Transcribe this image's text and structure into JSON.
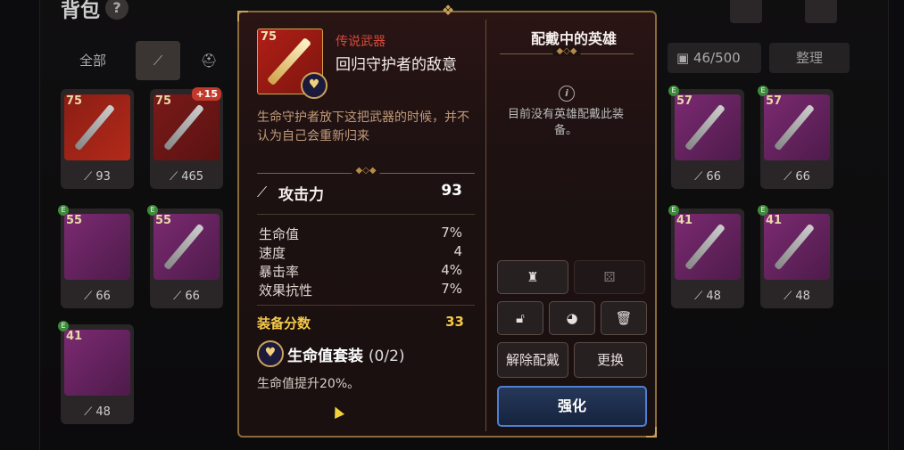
{
  "background": {
    "title": "背包",
    "help_icon": "question-icon",
    "tabs": [
      "全部",
      "",
      ""
    ],
    "inventory_count": "46/500",
    "sort_label": "整理",
    "slots_left": [
      {
        "level": "75",
        "power": "93"
      },
      {
        "level": "75",
        "power": "465",
        "plus": "+15"
      },
      {
        "level": "55",
        "power": "66"
      },
      {
        "level": "55",
        "power": "66"
      },
      {
        "level": "41",
        "power": "48"
      }
    ],
    "slots_right": [
      {
        "level": "57",
        "power": "66"
      },
      {
        "level": "57",
        "power": "66"
      },
      {
        "level": "41",
        "power": "48"
      },
      {
        "level": "41",
        "power": "48"
      }
    ]
  },
  "item": {
    "level": "75",
    "rarity": "传说武器",
    "name": "回归守护者的敌意",
    "flavor": "生命守护者放下这把武器的时候，并不认为自己会重新归来",
    "attack_label": "攻击力",
    "attack_value": "93",
    "stats": [
      {
        "name": "生命值",
        "value": "7%"
      },
      {
        "name": "速度",
        "value": "4"
      },
      {
        "name": "暴击率",
        "value": "4%"
      },
      {
        "name": "效果抗性",
        "value": "7%"
      }
    ],
    "gear_score_label": "装备分数",
    "gear_score_value": "33",
    "set_name": "生命值套装",
    "set_count": "(0/2)",
    "set_effect": "生命值提升20%。"
  },
  "equipped": {
    "title": "配戴中的英雄",
    "empty_text": "目前没有英雄配戴此装备。"
  },
  "actions": {
    "unequip": "解除配戴",
    "replace": "更换",
    "enhance": "强化"
  },
  "colors": {
    "rarity": "#d64a3a",
    "gear_score": "#f2c84a",
    "enhance_border": "#4f7fd0"
  }
}
